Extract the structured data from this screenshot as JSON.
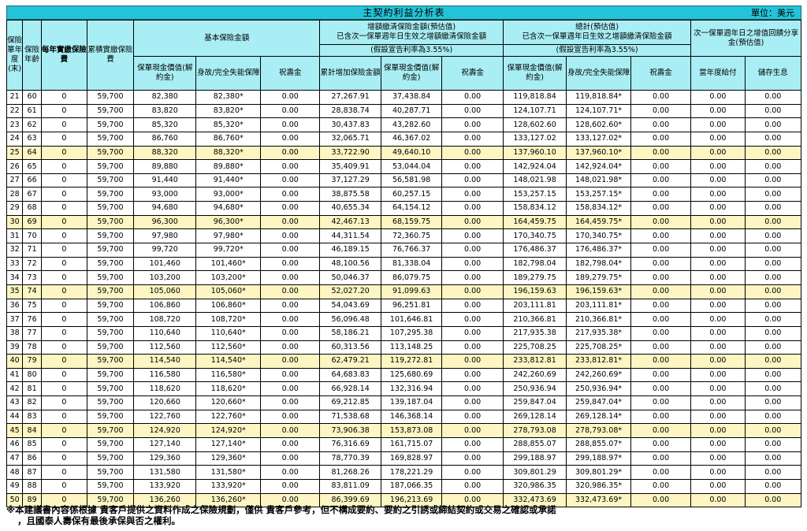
{
  "header": {
    "title": "主契約利益分析表",
    "unit": "單位：美元"
  },
  "columns": {
    "policy_year": "保險單年度(末)",
    "age": "保險年齡",
    "annual_premium": "每年實繳保險費",
    "cumulative_premium": "累積實繳保險費",
    "basic_group": "基本保險金額",
    "increase_group_line1": "增額繳清保險金額(預估值)",
    "increase_group_line2": "已含次一保單週年日生效之增額繳清保險金額",
    "increase_rate_note": "(假設宣告利率為3.55%)",
    "total_group_line1": "總計(預估值)",
    "total_group_line2": "已含次一保單週年日生效之增額繳清保險金額",
    "total_rate_note": "(假設宣告利率為3.55%)",
    "refund_group": "次一保單週年日之增值回饋分享金(預估值)",
    "cash_value": "保單現金價值(解約金)",
    "death_benefit": "身故/完全失能保障",
    "birthday_gift": "祝壽金",
    "cumulative_increase": "累計增加保險金額",
    "current_year_payment": "當年度給付",
    "deposit_interest": "儲存生息"
  },
  "rows": [
    {
      "year": "21",
      "age": "60",
      "premium": "0",
      "cum": "59,700",
      "cv": "82,380",
      "db": "82,380*",
      "gift": "0.00",
      "inc": "27,267.91",
      "icv": "37,438.84",
      "igift": "0.00",
      "tcv": "119,818.84",
      "tdb": "119,818.84*",
      "tgift": "0.00",
      "pay": "0.00",
      "int": "0.00",
      "hl": false
    },
    {
      "year": "22",
      "age": "61",
      "premium": "0",
      "cum": "59,700",
      "cv": "83,820",
      "db": "83,820*",
      "gift": "0.00",
      "inc": "28,838.74",
      "icv": "40,287.71",
      "igift": "0.00",
      "tcv": "124,107.71",
      "tdb": "124,107.71*",
      "tgift": "0.00",
      "pay": "0.00",
      "int": "0.00",
      "hl": false
    },
    {
      "year": "23",
      "age": "62",
      "premium": "0",
      "cum": "59,700",
      "cv": "85,320",
      "db": "85,320*",
      "gift": "0.00",
      "inc": "30,437.83",
      "icv": "43,282.60",
      "igift": "0.00",
      "tcv": "128,602.60",
      "tdb": "128,602.60*",
      "tgift": "0.00",
      "pay": "0.00",
      "int": "0.00",
      "hl": false
    },
    {
      "year": "24",
      "age": "63",
      "premium": "0",
      "cum": "59,700",
      "cv": "86,760",
      "db": "86,760*",
      "gift": "0.00",
      "inc": "32,065.71",
      "icv": "46,367.02",
      "igift": "0.00",
      "tcv": "133,127.02",
      "tdb": "133,127.02*",
      "tgift": "0.00",
      "pay": "0.00",
      "int": "0.00",
      "hl": false
    },
    {
      "year": "25",
      "age": "64",
      "premium": "0",
      "cum": "59,700",
      "cv": "88,320",
      "db": "88,320*",
      "gift": "0.00",
      "inc": "33,722.90",
      "icv": "49,640.10",
      "igift": "0.00",
      "tcv": "137,960.10",
      "tdb": "137,960.10*",
      "tgift": "0.00",
      "pay": "0.00",
      "int": "0.00",
      "hl": true
    },
    {
      "year": "26",
      "age": "65",
      "premium": "0",
      "cum": "59,700",
      "cv": "89,880",
      "db": "89,880*",
      "gift": "0.00",
      "inc": "35,409.91",
      "icv": "53,044.04",
      "igift": "0.00",
      "tcv": "142,924.04",
      "tdb": "142,924.04*",
      "tgift": "0.00",
      "pay": "0.00",
      "int": "0.00",
      "hl": false
    },
    {
      "year": "27",
      "age": "66",
      "premium": "0",
      "cum": "59,700",
      "cv": "91,440",
      "db": "91,440*",
      "gift": "0.00",
      "inc": "37,127.29",
      "icv": "56,581.98",
      "igift": "0.00",
      "tcv": "148,021.98",
      "tdb": "148,021.98*",
      "tgift": "0.00",
      "pay": "0.00",
      "int": "0.00",
      "hl": false
    },
    {
      "year": "28",
      "age": "67",
      "premium": "0",
      "cum": "59,700",
      "cv": "93,000",
      "db": "93,000*",
      "gift": "0.00",
      "inc": "38,875.58",
      "icv": "60,257.15",
      "igift": "0.00",
      "tcv": "153,257.15",
      "tdb": "153,257.15*",
      "tgift": "0.00",
      "pay": "0.00",
      "int": "0.00",
      "hl": false
    },
    {
      "year": "29",
      "age": "68",
      "premium": "0",
      "cum": "59,700",
      "cv": "94,680",
      "db": "94,680*",
      "gift": "0.00",
      "inc": "40,655.34",
      "icv": "64,154.12",
      "igift": "0.00",
      "tcv": "158,834.12",
      "tdb": "158,834.12*",
      "tgift": "0.00",
      "pay": "0.00",
      "int": "0.00",
      "hl": false
    },
    {
      "year": "30",
      "age": "69",
      "premium": "0",
      "cum": "59,700",
      "cv": "96,300",
      "db": "96,300*",
      "gift": "0.00",
      "inc": "42,467.13",
      "icv": "68,159.75",
      "igift": "0.00",
      "tcv": "164,459.75",
      "tdb": "164,459.75*",
      "tgift": "0.00",
      "pay": "0.00",
      "int": "0.00",
      "hl": true
    },
    {
      "year": "31",
      "age": "70",
      "premium": "0",
      "cum": "59,700",
      "cv": "97,980",
      "db": "97,980*",
      "gift": "0.00",
      "inc": "44,311.54",
      "icv": "72,360.75",
      "igift": "0.00",
      "tcv": "170,340.75",
      "tdb": "170,340.75*",
      "tgift": "0.00",
      "pay": "0.00",
      "int": "0.00",
      "hl": false
    },
    {
      "year": "32",
      "age": "71",
      "premium": "0",
      "cum": "59,700",
      "cv": "99,720",
      "db": "99,720*",
      "gift": "0.00",
      "inc": "46,189.15",
      "icv": "76,766.37",
      "igift": "0.00",
      "tcv": "176,486.37",
      "tdb": "176,486.37*",
      "tgift": "0.00",
      "pay": "0.00",
      "int": "0.00",
      "hl": false
    },
    {
      "year": "33",
      "age": "72",
      "premium": "0",
      "cum": "59,700",
      "cv": "101,460",
      "db": "101,460*",
      "gift": "0.00",
      "inc": "48,100.56",
      "icv": "81,338.04",
      "igift": "0.00",
      "tcv": "182,798.04",
      "tdb": "182,798.04*",
      "tgift": "0.00",
      "pay": "0.00",
      "int": "0.00",
      "hl": false
    },
    {
      "year": "34",
      "age": "73",
      "premium": "0",
      "cum": "59,700",
      "cv": "103,200",
      "db": "103,200*",
      "gift": "0.00",
      "inc": "50,046.37",
      "icv": "86,079.75",
      "igift": "0.00",
      "tcv": "189,279.75",
      "tdb": "189,279.75*",
      "tgift": "0.00",
      "pay": "0.00",
      "int": "0.00",
      "hl": false
    },
    {
      "year": "35",
      "age": "74",
      "premium": "0",
      "cum": "59,700",
      "cv": "105,060",
      "db": "105,060*",
      "gift": "0.00",
      "inc": "52,027.20",
      "icv": "91,099.63",
      "igift": "0.00",
      "tcv": "196,159.63",
      "tdb": "196,159.63*",
      "tgift": "0.00",
      "pay": "0.00",
      "int": "0.00",
      "hl": true
    },
    {
      "year": "36",
      "age": "75",
      "premium": "0",
      "cum": "59,700",
      "cv": "106,860",
      "db": "106,860*",
      "gift": "0.00",
      "inc": "54,043.69",
      "icv": "96,251.81",
      "igift": "0.00",
      "tcv": "203,111.81",
      "tdb": "203,111.81*",
      "tgift": "0.00",
      "pay": "0.00",
      "int": "0.00",
      "hl": false
    },
    {
      "year": "37",
      "age": "76",
      "premium": "0",
      "cum": "59,700",
      "cv": "108,720",
      "db": "108,720*",
      "gift": "0.00",
      "inc": "56,096.48",
      "icv": "101,646.81",
      "igift": "0.00",
      "tcv": "210,366.81",
      "tdb": "210,366.81*",
      "tgift": "0.00",
      "pay": "0.00",
      "int": "0.00",
      "hl": false
    },
    {
      "year": "38",
      "age": "77",
      "premium": "0",
      "cum": "59,700",
      "cv": "110,640",
      "db": "110,640*",
      "gift": "0.00",
      "inc": "58,186.21",
      "icv": "107,295.38",
      "igift": "0.00",
      "tcv": "217,935.38",
      "tdb": "217,935.38*",
      "tgift": "0.00",
      "pay": "0.00",
      "int": "0.00",
      "hl": false
    },
    {
      "year": "39",
      "age": "78",
      "premium": "0",
      "cum": "59,700",
      "cv": "112,560",
      "db": "112,560*",
      "gift": "0.00",
      "inc": "60,313.56",
      "icv": "113,148.25",
      "igift": "0.00",
      "tcv": "225,708.25",
      "tdb": "225,708.25*",
      "tgift": "0.00",
      "pay": "0.00",
      "int": "0.00",
      "hl": false
    },
    {
      "year": "40",
      "age": "79",
      "premium": "0",
      "cum": "59,700",
      "cv": "114,540",
      "db": "114,540*",
      "gift": "0.00",
      "inc": "62,479.21",
      "icv": "119,272.81",
      "igift": "0.00",
      "tcv": "233,812.81",
      "tdb": "233,812.81*",
      "tgift": "0.00",
      "pay": "0.00",
      "int": "0.00",
      "hl": true
    },
    {
      "year": "41",
      "age": "80",
      "premium": "0",
      "cum": "59,700",
      "cv": "116,580",
      "db": "116,580*",
      "gift": "0.00",
      "inc": "64,683.83",
      "icv": "125,680.69",
      "igift": "0.00",
      "tcv": "242,260.69",
      "tdb": "242,260.69*",
      "tgift": "0.00",
      "pay": "0.00",
      "int": "0.00",
      "hl": false
    },
    {
      "year": "42",
      "age": "81",
      "premium": "0",
      "cum": "59,700",
      "cv": "118,620",
      "db": "118,620*",
      "gift": "0.00",
      "inc": "66,928.14",
      "icv": "132,316.94",
      "igift": "0.00",
      "tcv": "250,936.94",
      "tdb": "250,936.94*",
      "tgift": "0.00",
      "pay": "0.00",
      "int": "0.00",
      "hl": false
    },
    {
      "year": "43",
      "age": "82",
      "premium": "0",
      "cum": "59,700",
      "cv": "120,660",
      "db": "120,660*",
      "gift": "0.00",
      "inc": "69,212.85",
      "icv": "139,187.04",
      "igift": "0.00",
      "tcv": "259,847.04",
      "tdb": "259,847.04*",
      "tgift": "0.00",
      "pay": "0.00",
      "int": "0.00",
      "hl": false
    },
    {
      "year": "44",
      "age": "83",
      "premium": "0",
      "cum": "59,700",
      "cv": "122,760",
      "db": "122,760*",
      "gift": "0.00",
      "inc": "71,538.68",
      "icv": "146,368.14",
      "igift": "0.00",
      "tcv": "269,128.14",
      "tdb": "269,128.14*",
      "tgift": "0.00",
      "pay": "0.00",
      "int": "0.00",
      "hl": false
    },
    {
      "year": "45",
      "age": "84",
      "premium": "0",
      "cum": "59,700",
      "cv": "124,920",
      "db": "124,920*",
      "gift": "0.00",
      "inc": "73,906.38",
      "icv": "153,873.08",
      "igift": "0.00",
      "tcv": "278,793.08",
      "tdb": "278,793.08*",
      "tgift": "0.00",
      "pay": "0.00",
      "int": "0.00",
      "hl": true
    },
    {
      "year": "46",
      "age": "85",
      "premium": "0",
      "cum": "59,700",
      "cv": "127,140",
      "db": "127,140*",
      "gift": "0.00",
      "inc": "76,316.69",
      "icv": "161,715.07",
      "igift": "0.00",
      "tcv": "288,855.07",
      "tdb": "288,855.07*",
      "tgift": "0.00",
      "pay": "0.00",
      "int": "0.00",
      "hl": false
    },
    {
      "year": "47",
      "age": "86",
      "premium": "0",
      "cum": "59,700",
      "cv": "129,360",
      "db": "129,360*",
      "gift": "0.00",
      "inc": "78,770.39",
      "icv": "169,828.97",
      "igift": "0.00",
      "tcv": "299,188.97",
      "tdb": "299,188.97*",
      "tgift": "0.00",
      "pay": "0.00",
      "int": "0.00",
      "hl": false
    },
    {
      "year": "48",
      "age": "87",
      "premium": "0",
      "cum": "59,700",
      "cv": "131,580",
      "db": "131,580*",
      "gift": "0.00",
      "inc": "81,268.26",
      "icv": "178,221.29",
      "igift": "0.00",
      "tcv": "309,801.29",
      "tdb": "309,801.29*",
      "tgift": "0.00",
      "pay": "0.00",
      "int": "0.00",
      "hl": false
    },
    {
      "year": "49",
      "age": "88",
      "premium": "0",
      "cum": "59,700",
      "cv": "133,920",
      "db": "133,920*",
      "gift": "0.00",
      "inc": "83,811.09",
      "icv": "187,066.35",
      "igift": "0.00",
      "tcv": "320,986.35",
      "tdb": "320,986.35*",
      "tgift": "0.00",
      "pay": "0.00",
      "int": "0.00",
      "hl": false
    },
    {
      "year": "50",
      "age": "89",
      "premium": "0",
      "cum": "59,700",
      "cv": "136,260",
      "db": "136,260*",
      "gift": "0.00",
      "inc": "86,399.69",
      "icv": "196,213.69",
      "igift": "0.00",
      "tcv": "332,473.69",
      "tdb": "332,473.69*",
      "tgift": "0.00",
      "pay": "0.00",
      "int": "0.00",
      "hl": true
    }
  ],
  "footer": {
    "line1": "※本建議書內容係根據 貴客戶提供之資料作成之保險規劃，僅供 貴客戶參考，但不構成要約、要約之引誘或締結契約或交易之確認或承諾",
    "line2": "，且國泰人壽保有最後承保與否之權利。"
  },
  "colors": {
    "title_bar": "#25c3d8",
    "header_bg": "#a9eef4",
    "highlight_row": "#fdf6c3"
  }
}
